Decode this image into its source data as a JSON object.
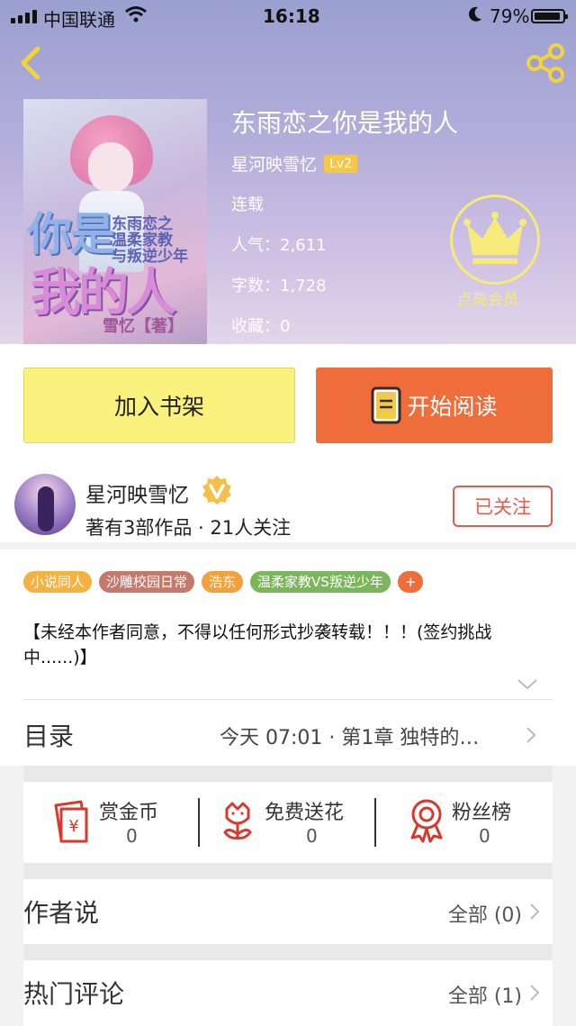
{
  "status_bar": {
    "carrier": "中国联通",
    "time": "16:18",
    "battery": "79%"
  },
  "book": {
    "title": "东雨恋之你是我的人",
    "author": "星河映雪忆",
    "level": "Lv2",
    "status": "连载",
    "popularity_label": "人气：",
    "popularity": "2,611",
    "words_label": "字数：",
    "words": "1,728",
    "favorites_label": "收藏：",
    "favorites": "0",
    "cover": {
      "title_top": "你是",
      "subtitle_line1": "东雨恋之",
      "subtitle_line2": "温柔家教",
      "subtitle_line3": "与叛逆少年",
      "title_bottom": "我的人",
      "credit": "雪忆【著】"
    }
  },
  "member": {
    "label": "点亮会员"
  },
  "actions": {
    "add_shelf": "加入书架",
    "start_read": "开始阅读"
  },
  "author_card": {
    "name": "星河映雪忆",
    "works": "著有3部作品 · 21人关注",
    "follow": "已关注"
  },
  "tags": [
    {
      "label": "小说同人",
      "color": "#f4b243"
    },
    {
      "label": "沙雕校园日常",
      "color": "#c47a6b"
    },
    {
      "label": "浩东",
      "color": "#f1a23e"
    },
    {
      "label": "温柔家教VS叛逆少年",
      "color": "#7cb65c"
    },
    {
      "label": "+",
      "color": "#ef6d3b"
    }
  ],
  "notice": "【未经本作者同意，不得以任何形式抄袭转载！！！(签约挑战中......)】",
  "toc": {
    "label": "目录",
    "latest": "今天 07:01 · 第1章 独特的…"
  },
  "stats": [
    {
      "label": "赏金币",
      "value": "0",
      "icon": "red-envelope-icon"
    },
    {
      "label": "免费送花",
      "value": "0",
      "icon": "flower-icon"
    },
    {
      "label": "粉丝榜",
      "value": "0",
      "icon": "medal-icon"
    }
  ],
  "author_says": {
    "label": "作者说",
    "all": "全部 (0)"
  },
  "hot_comments": {
    "label": "热门评论",
    "all": "全部 (1)"
  },
  "colors": {
    "accent_orange": "#ef6d3b",
    "shelf_yellow": "#fbf17d",
    "follow_red": "#e45a4d",
    "crown_yellow": "#f6ea7a"
  }
}
